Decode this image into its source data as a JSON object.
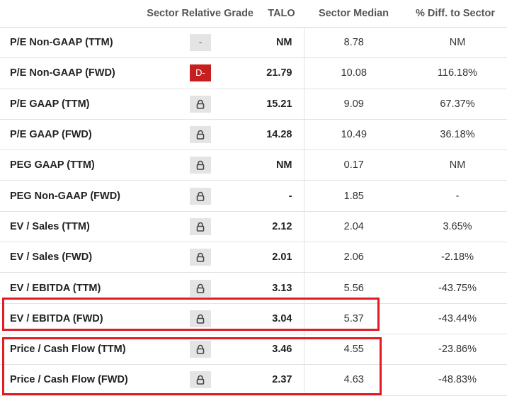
{
  "header": {
    "metric": "",
    "grade": "Sector Relative Grade",
    "ticker": "TALO",
    "median": "Sector Median",
    "diff": "% Diff. to Sector"
  },
  "rows": [
    {
      "metric": "P/E Non-GAAP (TTM)",
      "grade": "-",
      "grade_kind": "neutral",
      "talo": "NM",
      "median": "8.78",
      "diff": "NM"
    },
    {
      "metric": "P/E Non-GAAP (FWD)",
      "grade": "D-",
      "grade_kind": "bad",
      "talo": "21.79",
      "median": "10.08",
      "diff": "116.18%"
    },
    {
      "metric": "P/E GAAP (TTM)",
      "grade": "",
      "grade_kind": "locked",
      "talo": "15.21",
      "median": "9.09",
      "diff": "67.37%"
    },
    {
      "metric": "P/E GAAP (FWD)",
      "grade": "",
      "grade_kind": "locked",
      "talo": "14.28",
      "median": "10.49",
      "diff": "36.18%"
    },
    {
      "metric": "PEG GAAP (TTM)",
      "grade": "",
      "grade_kind": "locked",
      "talo": "NM",
      "median": "0.17",
      "diff": "NM"
    },
    {
      "metric": "PEG Non-GAAP (FWD)",
      "grade": "",
      "grade_kind": "locked",
      "talo": "-",
      "median": "1.85",
      "diff": "-"
    },
    {
      "metric": "EV / Sales (TTM)",
      "grade": "",
      "grade_kind": "locked",
      "talo": "2.12",
      "median": "2.04",
      "diff": "3.65%"
    },
    {
      "metric": "EV / Sales (FWD)",
      "grade": "",
      "grade_kind": "locked",
      "talo": "2.01",
      "median": "2.06",
      "diff": "-2.18%"
    },
    {
      "metric": "EV / EBITDA (TTM)",
      "grade": "",
      "grade_kind": "locked",
      "talo": "3.13",
      "median": "5.56",
      "diff": "-43.75%"
    },
    {
      "metric": "EV / EBITDA (FWD)",
      "grade": "",
      "grade_kind": "locked",
      "talo": "3.04",
      "median": "5.37",
      "diff": "-43.44%"
    },
    {
      "metric": "Price / Cash Flow (TTM)",
      "grade": "",
      "grade_kind": "locked",
      "talo": "3.46",
      "median": "4.55",
      "diff": "-23.86%"
    },
    {
      "metric": "Price / Cash Flow (FWD)",
      "grade": "",
      "grade_kind": "locked",
      "talo": "2.37",
      "median": "4.63",
      "diff": "-48.83%"
    }
  ],
  "colors": {
    "highlight": "#e01b24",
    "grade_bad": "#c71f1f",
    "grade_neutral": "#e4e4e4"
  },
  "icons": {
    "locked_grade": "lock-icon"
  }
}
